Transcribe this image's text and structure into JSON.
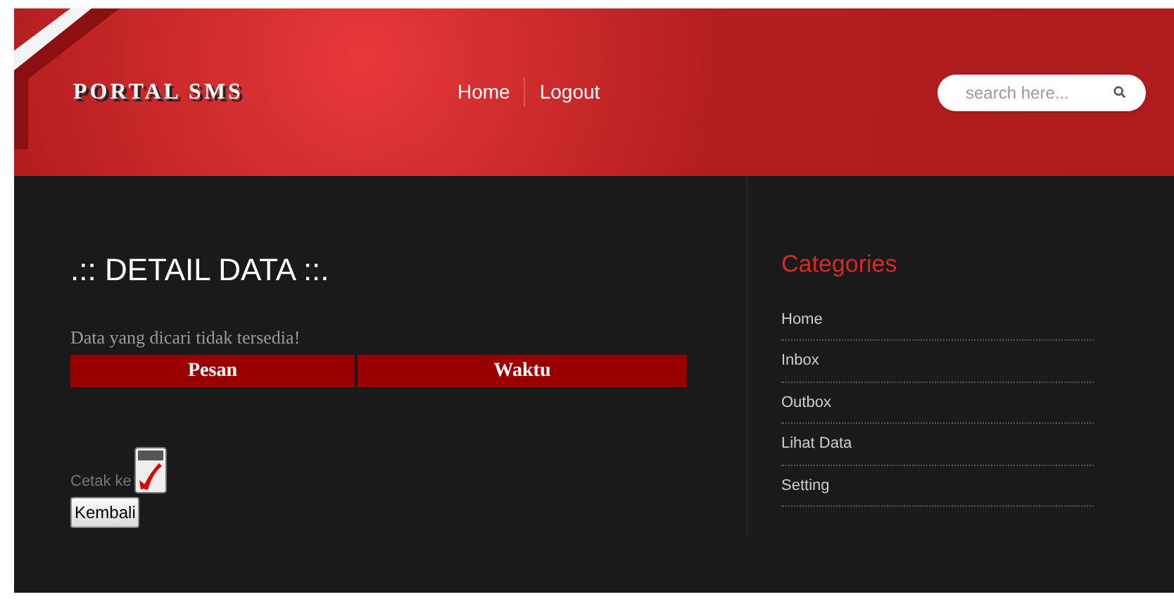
{
  "logo": "PORTAL SMS",
  "nav": [
    "Home",
    "Logout"
  ],
  "search": {
    "placeholder": "search here..."
  },
  "heading": ".:: DETAIL DATA ::.",
  "message": "Data yang dicari tidak tersedia!",
  "table": {
    "columns": [
      "Pesan",
      "Waktu"
    ]
  },
  "print_label": "Cetak ke",
  "back_button": "Kembali",
  "sidebar": {
    "title": "Categories",
    "items": [
      "Home",
      "Inbox",
      "Outbox",
      "Lihat Data",
      "Setting"
    ]
  }
}
